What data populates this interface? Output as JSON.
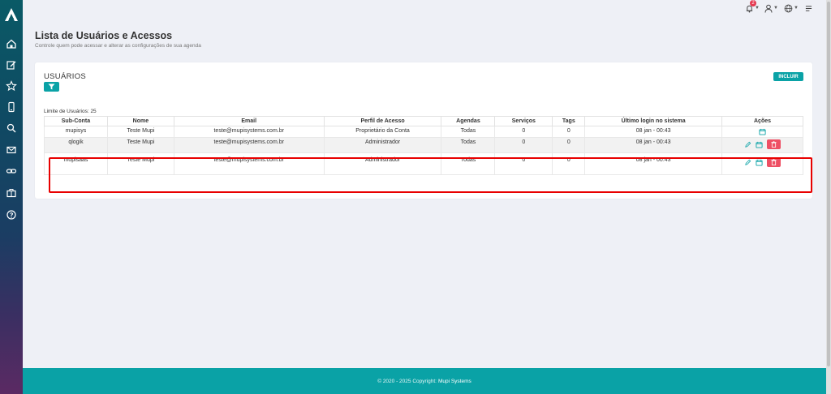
{
  "page": {
    "title": "Lista de Usuários e Acessos",
    "subtitle": "Controle quem pode acessar e alterar as configurações de sua agenda"
  },
  "topbar": {
    "notification_count": "2"
  },
  "card": {
    "title": "USUÁRIOS",
    "include_label": "INCLUIR",
    "limit_text": "Limite de Usuários: 25"
  },
  "table": {
    "headers": {
      "subconta": "Sub-Conta",
      "nome": "Nome",
      "email": "Email",
      "perfil": "Perfil de Acesso",
      "agendas": "Agendas",
      "servicos": "Serviços",
      "tags": "Tags",
      "login": "Último login no sistema",
      "acoes": "Ações"
    },
    "rows": [
      {
        "subconta": "mupisys",
        "nome": "Teste Mupi",
        "email": "teste@mupisystems.com.br",
        "perfil": "Proprietário da Conta",
        "agendas": "Todas",
        "servicos": "0",
        "tags": "0",
        "login": "08 jan - 00:43"
      },
      {
        "subconta": "qlogik",
        "nome": "Teste Mupi",
        "email": "teste@mupisystems.com.br",
        "perfil": "Administrador",
        "agendas": "Todas",
        "servicos": "0",
        "tags": "0",
        "login": "08 jan - 00:43"
      },
      {
        "subconta": "mupisaas",
        "nome": "Teste Mupi",
        "email": "teste@mupisystems.com.br",
        "perfil": "Administrador",
        "agendas": "Todas",
        "servicos": "0",
        "tags": "0",
        "login": "08 jan - 00:43"
      }
    ]
  },
  "footer": {
    "text": "© 2020 - 2025 Copyright:",
    "brand": "Mupi Systems"
  },
  "colors": {
    "accent": "#0aa2a6",
    "danger": "#ee5064",
    "highlight": "#e80000"
  }
}
